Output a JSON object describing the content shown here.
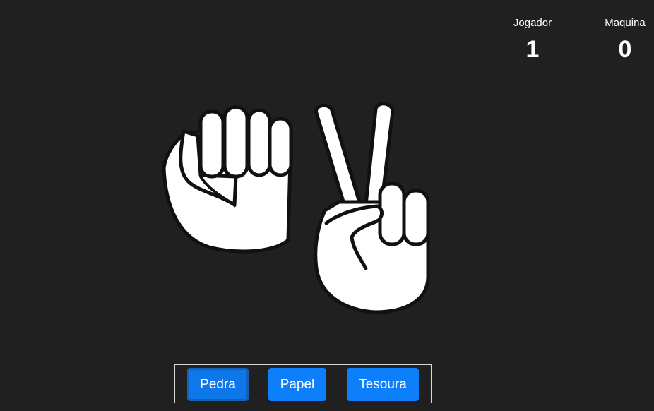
{
  "scoreboard": {
    "player_label": "Jogador",
    "player_score": "1",
    "machine_label": "Maquina",
    "machine_score": "0"
  },
  "hands": {
    "player_choice": "rock-hand-icon",
    "machine_choice": "scissors-hand-icon"
  },
  "controls": {
    "rock_label": "Pedra",
    "paper_label": "Papel",
    "scissors_label": "Tesoura",
    "selected": "Pedra"
  },
  "colors": {
    "background": "#202020",
    "button": "#0d7ffb",
    "text": "#ffffff"
  }
}
